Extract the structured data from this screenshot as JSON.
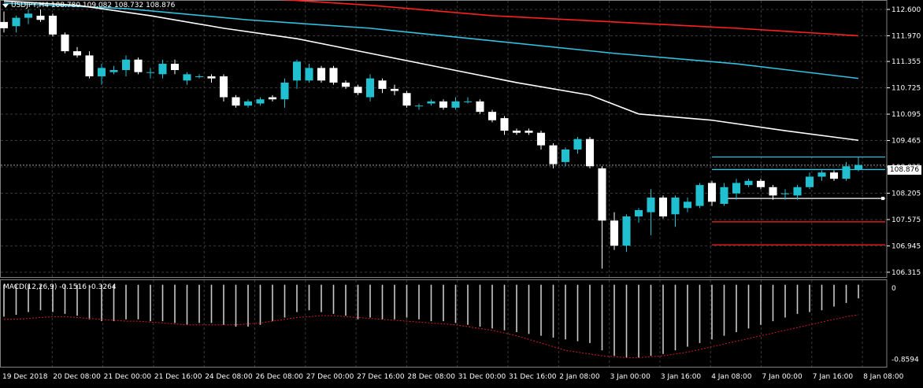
{
  "chart_data": [
    {
      "type": "candlestick",
      "title": "USDJPY,H4",
      "ohlc_readout": "108.780 109.082 108.732 108.876",
      "current_price_label": "108.876",
      "y_ticks": [
        "112.600",
        "111.970",
        "111.355",
        "110.725",
        "110.095",
        "109.465",
        "108.835",
        "108.205",
        "107.575",
        "106.945",
        "106.315"
      ],
      "y_tick_values": [
        112.6,
        111.97,
        111.355,
        110.725,
        110.095,
        109.465,
        108.835,
        108.205,
        107.575,
        106.945,
        106.315
      ],
      "ylim": [
        106.2,
        112.75
      ],
      "x_tick_labels": [
        "19 Dec 2018",
        "20 Dec 08:00",
        "21 Dec 00:00",
        "21 Dec 16:00",
        "24 Dec 08:00",
        "26 Dec 08:00",
        "27 Dec 00:00",
        "27 Dec 16:00",
        "28 Dec 08:00",
        "31 Dec 00:00",
        "31 Dec 16:00",
        "2 Jan 08:00",
        "3 Jan 00:00",
        "3 Jan 16:00",
        "4 Jan 08:00",
        "7 Jan 00:00",
        "7 Jan 16:00",
        "8 Jan 08:00"
      ],
      "candles": [
        {
          "o": 112.3,
          "h": 112.55,
          "l": 112.05,
          "c": 112.15
        },
        {
          "o": 112.2,
          "h": 112.45,
          "l": 112.05,
          "c": 112.4
        },
        {
          "o": 112.4,
          "h": 112.6,
          "l": 112.25,
          "c": 112.5
        },
        {
          "o": 112.45,
          "h": 112.6,
          "l": 112.3,
          "c": 112.35
        },
        {
          "o": 112.45,
          "h": 112.5,
          "l": 111.95,
          "c": 112.0
        },
        {
          "o": 112.0,
          "h": 112.05,
          "l": 111.55,
          "c": 111.6
        },
        {
          "o": 111.6,
          "h": 111.7,
          "l": 111.45,
          "c": 111.5
        },
        {
          "o": 111.5,
          "h": 111.6,
          "l": 110.95,
          "c": 111.0
        },
        {
          "o": 111.0,
          "h": 111.3,
          "l": 110.8,
          "c": 111.2
        },
        {
          "o": 111.1,
          "h": 111.25,
          "l": 111.05,
          "c": 111.15
        },
        {
          "o": 111.15,
          "h": 111.5,
          "l": 111.0,
          "c": 111.4
        },
        {
          "o": 111.4,
          "h": 111.45,
          "l": 111.05,
          "c": 111.1
        },
        {
          "o": 111.1,
          "h": 111.2,
          "l": 110.95,
          "c": 111.1
        },
        {
          "o": 111.05,
          "h": 111.4,
          "l": 110.95,
          "c": 111.3
        },
        {
          "o": 111.3,
          "h": 111.4,
          "l": 111.05,
          "c": 111.15
        },
        {
          "o": 110.9,
          "h": 111.1,
          "l": 110.8,
          "c": 111.05
        },
        {
          "o": 111.0,
          "h": 111.05,
          "l": 110.95,
          "c": 111.0
        },
        {
          "o": 111.0,
          "h": 111.05,
          "l": 110.85,
          "c": 110.95
        },
        {
          "o": 111.0,
          "h": 111.05,
          "l": 110.4,
          "c": 110.5
        },
        {
          "o": 110.5,
          "h": 110.55,
          "l": 110.25,
          "c": 110.3
        },
        {
          "o": 110.3,
          "h": 110.45,
          "l": 110.25,
          "c": 110.4
        },
        {
          "o": 110.35,
          "h": 110.5,
          "l": 110.3,
          "c": 110.45
        },
        {
          "o": 110.5,
          "h": 110.55,
          "l": 110.4,
          "c": 110.45
        },
        {
          "o": 110.45,
          "h": 110.95,
          "l": 110.25,
          "c": 110.85
        },
        {
          "o": 110.9,
          "h": 111.4,
          "l": 110.7,
          "c": 111.35
        },
        {
          "o": 110.9,
          "h": 111.3,
          "l": 110.85,
          "c": 111.2
        },
        {
          "o": 111.2,
          "h": 111.25,
          "l": 110.85,
          "c": 110.9
        },
        {
          "o": 111.2,
          "h": 111.25,
          "l": 110.8,
          "c": 110.85
        },
        {
          "o": 110.85,
          "h": 110.9,
          "l": 110.7,
          "c": 110.75
        },
        {
          "o": 110.75,
          "h": 110.8,
          "l": 110.55,
          "c": 110.6
        },
        {
          "o": 110.5,
          "h": 111.05,
          "l": 110.4,
          "c": 110.95
        },
        {
          "o": 110.9,
          "h": 110.95,
          "l": 110.6,
          "c": 110.7
        },
        {
          "o": 110.7,
          "h": 110.8,
          "l": 110.55,
          "c": 110.65
        },
        {
          "o": 110.6,
          "h": 110.65,
          "l": 110.25,
          "c": 110.3
        },
        {
          "o": 110.3,
          "h": 110.35,
          "l": 110.2,
          "c": 110.3
        },
        {
          "o": 110.35,
          "h": 110.45,
          "l": 110.3,
          "c": 110.4
        },
        {
          "o": 110.4,
          "h": 110.45,
          "l": 110.2,
          "c": 110.25
        },
        {
          "o": 110.25,
          "h": 110.5,
          "l": 110.2,
          "c": 110.4
        },
        {
          "o": 110.4,
          "h": 110.5,
          "l": 110.35,
          "c": 110.4
        },
        {
          "o": 110.4,
          "h": 110.45,
          "l": 110.1,
          "c": 110.15
        },
        {
          "o": 110.15,
          "h": 110.2,
          "l": 109.9,
          "c": 109.95
        },
        {
          "o": 110.0,
          "h": 110.05,
          "l": 109.6,
          "c": 109.7
        },
        {
          "o": 109.7,
          "h": 109.75,
          "l": 109.6,
          "c": 109.65
        },
        {
          "o": 109.7,
          "h": 109.75,
          "l": 109.6,
          "c": 109.65
        },
        {
          "o": 109.65,
          "h": 109.7,
          "l": 109.25,
          "c": 109.35
        },
        {
          "o": 109.35,
          "h": 109.4,
          "l": 108.8,
          "c": 108.9
        },
        {
          "o": 108.95,
          "h": 109.3,
          "l": 108.85,
          "c": 109.25
        },
        {
          "o": 109.25,
          "h": 109.55,
          "l": 109.15,
          "c": 109.5
        },
        {
          "o": 109.5,
          "h": 109.55,
          "l": 108.8,
          "c": 108.85
        },
        {
          "o": 108.8,
          "h": 108.85,
          "l": 106.4,
          "c": 107.55
        },
        {
          "o": 107.55,
          "h": 107.75,
          "l": 106.85,
          "c": 106.95
        },
        {
          "o": 106.95,
          "h": 107.7,
          "l": 106.8,
          "c": 107.65
        },
        {
          "o": 107.65,
          "h": 107.85,
          "l": 107.5,
          "c": 107.8
        },
        {
          "o": 107.75,
          "h": 108.3,
          "l": 107.2,
          "c": 108.1
        },
        {
          "o": 108.1,
          "h": 108.15,
          "l": 107.6,
          "c": 107.65
        },
        {
          "o": 107.7,
          "h": 108.15,
          "l": 107.4,
          "c": 108.1
        },
        {
          "o": 107.85,
          "h": 108.1,
          "l": 107.75,
          "c": 108.0
        },
        {
          "o": 107.9,
          "h": 108.45,
          "l": 107.85,
          "c": 108.4
        },
        {
          "o": 108.45,
          "h": 108.5,
          "l": 107.9,
          "c": 108.0
        },
        {
          "o": 107.95,
          "h": 108.45,
          "l": 107.9,
          "c": 108.35
        },
        {
          "o": 108.2,
          "h": 108.55,
          "l": 108.05,
          "c": 108.45
        },
        {
          "o": 108.4,
          "h": 108.55,
          "l": 108.35,
          "c": 108.5
        },
        {
          "o": 108.5,
          "h": 108.55,
          "l": 108.3,
          "c": 108.35
        },
        {
          "o": 108.35,
          "h": 108.4,
          "l": 108.05,
          "c": 108.15
        },
        {
          "o": 108.2,
          "h": 108.3,
          "l": 108.05,
          "c": 108.2
        },
        {
          "o": 108.15,
          "h": 108.4,
          "l": 108.05,
          "c": 108.35
        },
        {
          "o": 108.35,
          "h": 108.7,
          "l": 108.3,
          "c": 108.6
        },
        {
          "o": 108.6,
          "h": 108.75,
          "l": 108.5,
          "c": 108.7
        },
        {
          "o": 108.7,
          "h": 108.75,
          "l": 108.5,
          "c": 108.55
        },
        {
          "o": 108.55,
          "h": 108.95,
          "l": 108.5,
          "c": 108.85
        },
        {
          "o": 108.78,
          "h": 109.08,
          "l": 108.73,
          "c": 108.88
        }
      ],
      "moving_averages": [
        {
          "color": "#ff2020",
          "points": [
            [
              22,
              112.85
            ],
            [
              30,
              112.7
            ],
            [
              40,
              112.45
            ],
            [
              50,
              112.3
            ],
            [
              60,
              112.15
            ],
            [
              70,
              111.97
            ]
          ]
        },
        {
          "color": "#33c1e0",
          "points": [
            [
              0,
              112.75
            ],
            [
              10,
              112.62
            ],
            [
              20,
              112.35
            ],
            [
              30,
              112.15
            ],
            [
              40,
              111.85
            ],
            [
              50,
              111.55
            ],
            [
              60,
              111.3
            ],
            [
              70,
              110.95
            ]
          ]
        },
        {
          "color": "#ffffff",
          "points": [
            [
              0,
              112.8
            ],
            [
              6,
              112.7
            ],
            [
              12,
              112.45
            ],
            [
              18,
              112.15
            ],
            [
              24,
              111.9
            ],
            [
              30,
              111.55
            ],
            [
              36,
              111.2
            ],
            [
              42,
              110.85
            ],
            [
              48,
              110.55
            ],
            [
              52,
              110.1
            ],
            [
              58,
              109.95
            ],
            [
              64,
              109.7
            ],
            [
              70,
              109.47
            ]
          ]
        }
      ],
      "h_levels": [
        {
          "color": "#33c1e0",
          "value": 109.07,
          "start": 58
        },
        {
          "color": "#33c1e0",
          "value": 108.77,
          "start": 58
        },
        {
          "color": "#ffffff",
          "value": 108.08,
          "start": 59
        },
        {
          "color": "#ff2020",
          "value": 107.52,
          "start": 58
        },
        {
          "color": "#ff2020",
          "value": 106.97,
          "start": 58
        }
      ],
      "colors": {
        "bull": "#20c0d0",
        "bear": "#ffffff",
        "grid": "#3a3a3a",
        "bg": "#000000",
        "axis": "#ffffff"
      }
    },
    {
      "type": "bar",
      "title": "MACD(12,26,9) -0.1516 -0.3264",
      "y_ticks": [
        "0",
        "-0.8594"
      ],
      "y_tick_values": [
        0,
        -0.8594
      ],
      "ylim": [
        -0.9,
        0.05
      ],
      "histogram": [
        -0.35,
        -0.33,
        -0.3,
        -0.28,
        -0.3,
        -0.32,
        -0.34,
        -0.38,
        -0.4,
        -0.4,
        -0.38,
        -0.38,
        -0.4,
        -0.4,
        -0.42,
        -0.44,
        -0.42,
        -0.42,
        -0.44,
        -0.46,
        -0.46,
        -0.44,
        -0.4,
        -0.36,
        -0.3,
        -0.28,
        -0.3,
        -0.32,
        -0.34,
        -0.38,
        -0.36,
        -0.38,
        -0.38,
        -0.36,
        -0.38,
        -0.4,
        -0.4,
        -0.42,
        -0.44,
        -0.46,
        -0.48,
        -0.5,
        -0.52,
        -0.54,
        -0.56,
        -0.58,
        -0.6,
        -0.62,
        -0.64,
        -0.72,
        -0.78,
        -0.8,
        -0.8,
        -0.78,
        -0.76,
        -0.72,
        -0.68,
        -0.64,
        -0.6,
        -0.56,
        -0.52,
        -0.48,
        -0.44,
        -0.4,
        -0.36,
        -0.32,
        -0.3,
        -0.28,
        -0.24,
        -0.2,
        -0.15
      ],
      "signal": [
        -0.38,
        -0.38,
        -0.37,
        -0.36,
        -0.35,
        -0.35,
        -0.36,
        -0.37,
        -0.38,
        -0.39,
        -0.4,
        -0.4,
        -0.41,
        -0.42,
        -0.43,
        -0.44,
        -0.44,
        -0.44,
        -0.44,
        -0.44,
        -0.43,
        -0.42,
        -0.4,
        -0.38,
        -0.36,
        -0.35,
        -0.34,
        -0.34,
        -0.35,
        -0.36,
        -0.37,
        -0.38,
        -0.39,
        -0.4,
        -0.41,
        -0.42,
        -0.43,
        -0.44,
        -0.46,
        -0.48,
        -0.5,
        -0.53,
        -0.56,
        -0.6,
        -0.64,
        -0.68,
        -0.72,
        -0.74,
        -0.76,
        -0.78,
        -0.79,
        -0.8,
        -0.8,
        -0.79,
        -0.78,
        -0.76,
        -0.74,
        -0.71,
        -0.68,
        -0.65,
        -0.62,
        -0.59,
        -0.56,
        -0.53,
        -0.5,
        -0.47,
        -0.44,
        -0.41,
        -0.38,
        -0.35,
        -0.33
      ],
      "colors": {
        "hist": "#c8c8c8",
        "signal": "#d02020"
      }
    }
  ]
}
